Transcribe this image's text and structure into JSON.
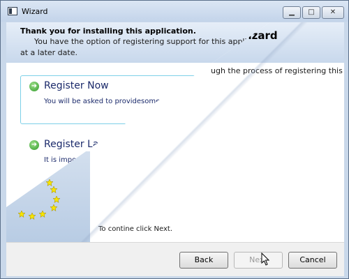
{
  "window": {
    "title": "Wizard"
  },
  "header": {
    "title": "Thank you for installing this application.",
    "line1": "You have the option of registering support for this application",
    "line2": "at a later date.",
    "wizard_title_fragment": "Wizard"
  },
  "body": {
    "intro_fragment": "ugh the process of registering this",
    "continue_text": "To contine click Next."
  },
  "options": [
    {
      "label": "Register Now",
      "description": "You will be asked to providesome registration."
    },
    {
      "label": "Register La",
      "description": "It is impo kept"
    }
  ],
  "buttons": {
    "back": "Back",
    "next": "Next",
    "cancel": "Cancel"
  },
  "colors": {
    "accent": "#7dd0e8",
    "link_text": "#1b2a6b",
    "band": "#c8d8ec",
    "star": "#f7e400"
  },
  "icons": {
    "arrow": "green-arrow-icon",
    "star": "star-icon"
  }
}
